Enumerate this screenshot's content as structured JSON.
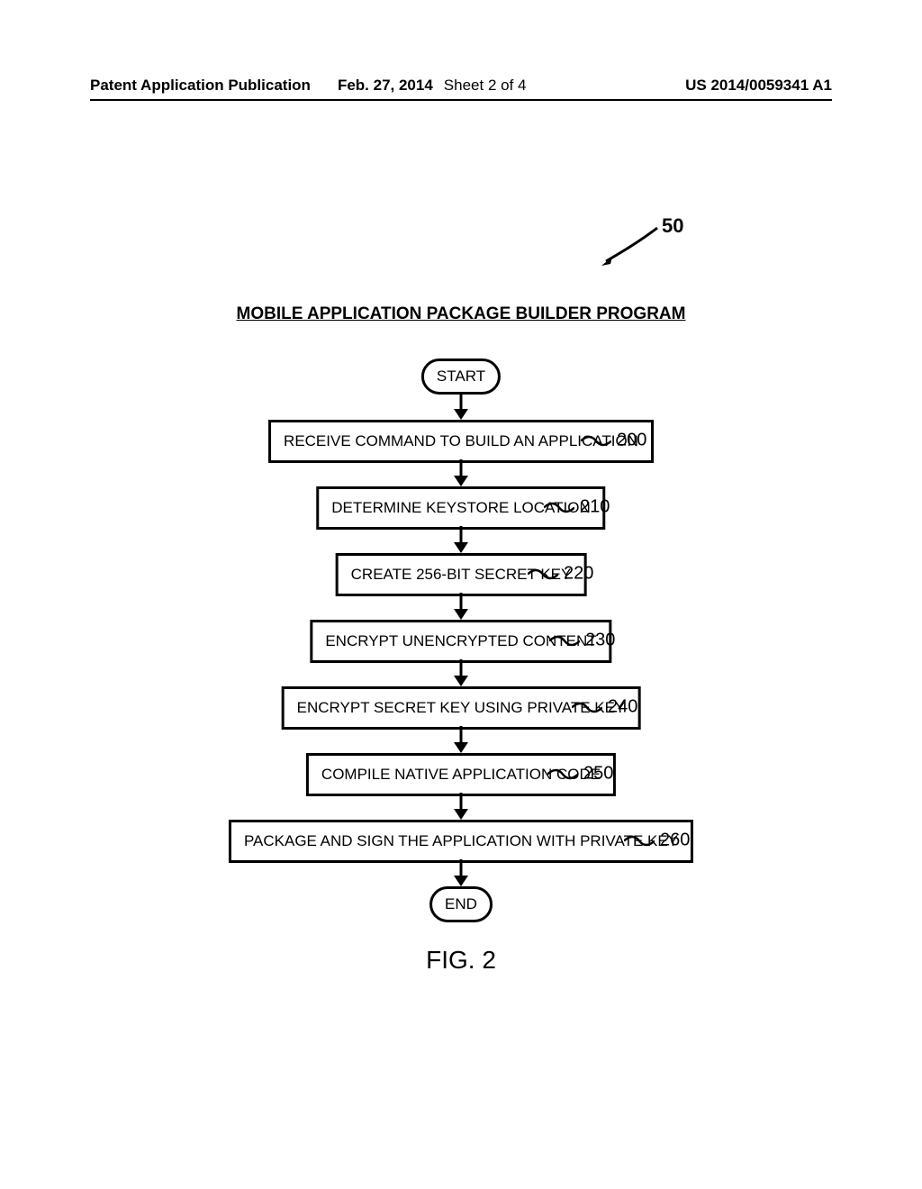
{
  "header": {
    "publication_label": "Patent Application Publication",
    "date": "Feb. 27, 2014",
    "sheet": "Sheet 2 of 4",
    "pub_number": "US 2014/0059341 A1"
  },
  "figure_ref": "50",
  "diagram_title": "MOBILE APPLICATION PACKAGE BUILDER PROGRAM",
  "terminals": {
    "start": "START",
    "end": "END"
  },
  "steps": [
    {
      "label": "RECEIVE COMMAND TO BUILD AN APPLICATION",
      "ref": "200"
    },
    {
      "label": "DETERMINE KEYSTORE LOCATION",
      "ref": "210"
    },
    {
      "label": "CREATE 256-BIT SECRET KEY",
      "ref": "220"
    },
    {
      "label": "ENCRYPT UNENCRYPTED CONTENT",
      "ref": "230"
    },
    {
      "label": "ENCRYPT SECRET KEY USING PRIVATE KEY",
      "ref": "240"
    },
    {
      "label": "COMPILE NATIVE APPLICATION CODE",
      "ref": "250"
    },
    {
      "label": "PACKAGE AND SIGN THE APPLICATION WITH PRIVATE KEY",
      "ref": "260"
    }
  ],
  "figure_caption": "FIG. 2",
  "chart_data": {
    "type": "flowchart",
    "title": "MOBILE APPLICATION PACKAGE BUILDER PROGRAM",
    "reference_numeral": 50,
    "nodes": [
      {
        "id": "start",
        "type": "terminal",
        "label": "START"
      },
      {
        "id": "200",
        "type": "process",
        "label": "RECEIVE COMMAND TO BUILD AN APPLICATION",
        "ref": 200
      },
      {
        "id": "210",
        "type": "process",
        "label": "DETERMINE KEYSTORE LOCATION",
        "ref": 210
      },
      {
        "id": "220",
        "type": "process",
        "label": "CREATE 256-BIT SECRET KEY",
        "ref": 220
      },
      {
        "id": "230",
        "type": "process",
        "label": "ENCRYPT UNENCRYPTED CONTENT",
        "ref": 230
      },
      {
        "id": "240",
        "type": "process",
        "label": "ENCRYPT SECRET KEY USING PRIVATE KEY",
        "ref": 240
      },
      {
        "id": "250",
        "type": "process",
        "label": "COMPILE NATIVE APPLICATION CODE",
        "ref": 250
      },
      {
        "id": "260",
        "type": "process",
        "label": "PACKAGE AND SIGN THE APPLICATION WITH PRIVATE KEY",
        "ref": 260
      },
      {
        "id": "end",
        "type": "terminal",
        "label": "END"
      }
    ],
    "edges": [
      [
        "start",
        "200"
      ],
      [
        "200",
        "210"
      ],
      [
        "210",
        "220"
      ],
      [
        "220",
        "230"
      ],
      [
        "230",
        "240"
      ],
      [
        "240",
        "250"
      ],
      [
        "250",
        "260"
      ],
      [
        "260",
        "end"
      ]
    ]
  }
}
